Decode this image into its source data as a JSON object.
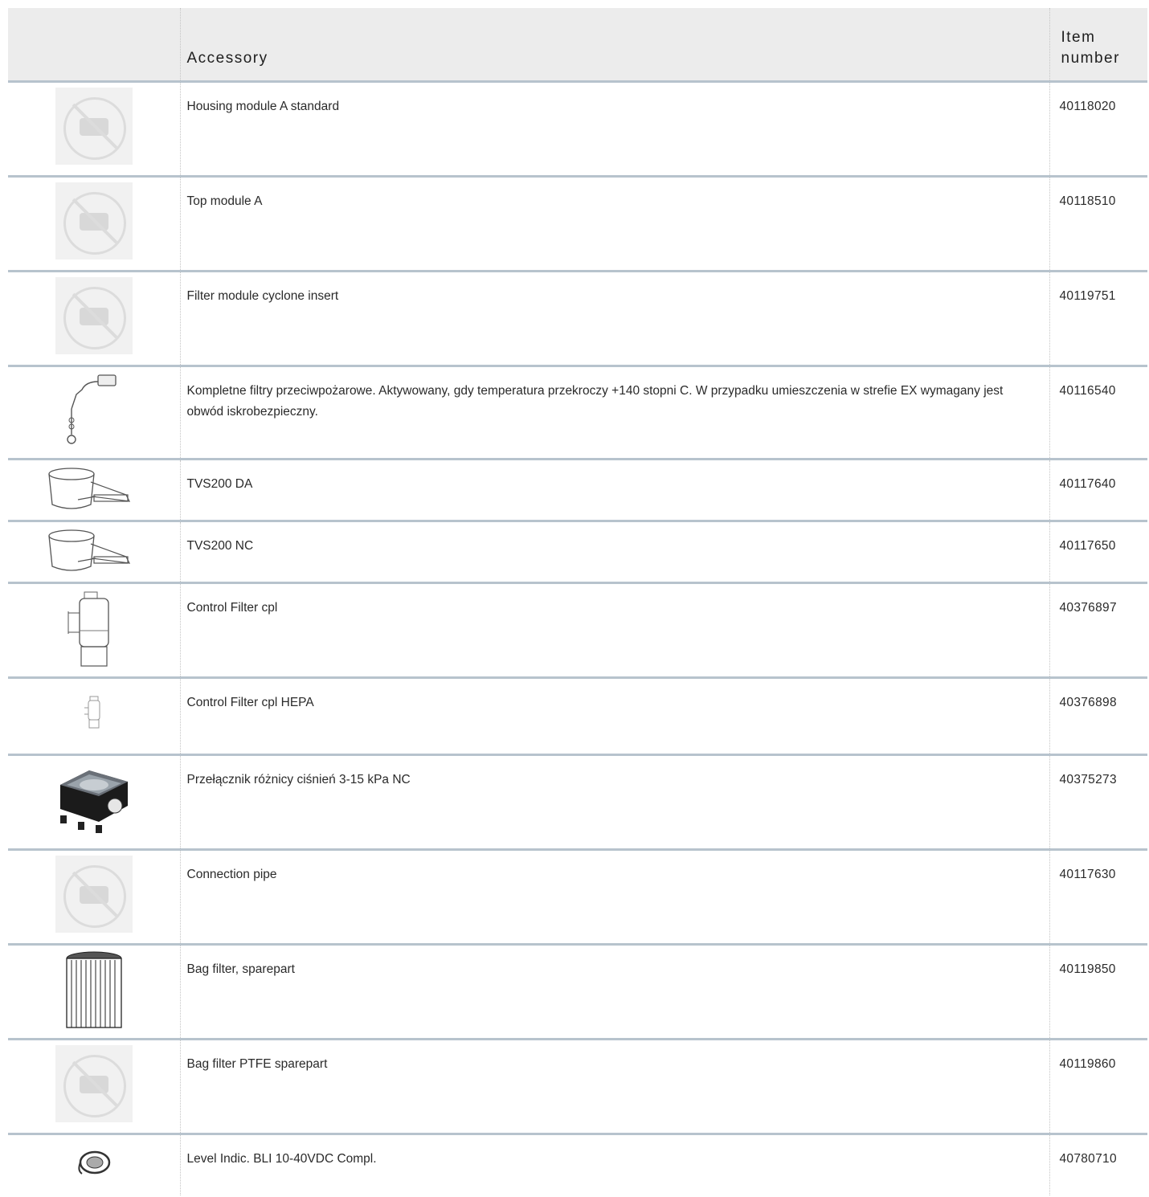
{
  "table": {
    "headers": {
      "accessory": "Accessory",
      "item_number_line1": "Item",
      "item_number_line2": "number"
    },
    "rows": [
      {
        "accessory": "Housing module A standard",
        "item_number": "40118020",
        "icon": "no-image-placeholder-icon"
      },
      {
        "accessory": "Top module A",
        "item_number": "40118510",
        "icon": "no-image-placeholder-icon"
      },
      {
        "accessory": "Filter module cyclone insert",
        "item_number": "40119751",
        "icon": "no-image-placeholder-icon"
      },
      {
        "accessory": "Kompletne filtry przeciwpożarowe. Aktywowany, gdy temperatura przekroczy +140 stopni C. W przypadku umieszczenia w strefie EX wymagany jest obwód iskrobezpieczny.",
        "item_number": "40116540",
        "icon": "fire-sensor-icon"
      },
      {
        "accessory": "TVS200 DA",
        "item_number": "40117640",
        "icon": "damper-valve-icon"
      },
      {
        "accessory": "TVS200 NC",
        "item_number": "40117650",
        "icon": "damper-valve-icon"
      },
      {
        "accessory": "Control Filter cpl",
        "item_number": "40376897",
        "icon": "control-filter-icon"
      },
      {
        "accessory": "Control Filter cpl HEPA",
        "item_number": "40376898",
        "icon": "control-filter-small-icon"
      },
      {
        "accessory": "Przełącznik różnicy ciśnień 3-15 kPa NC",
        "item_number": "40375273",
        "icon": "pressure-switch-icon"
      },
      {
        "accessory": "Connection pipe",
        "item_number": "40117630",
        "icon": "no-image-placeholder-icon"
      },
      {
        "accessory": "Bag filter, sparepart",
        "item_number": "40119850",
        "icon": "bag-filter-icon"
      },
      {
        "accessory": "Bag filter PTFE sparepart",
        "item_number": "40119860",
        "icon": "no-image-placeholder-icon"
      },
      {
        "accessory": "Level Indic. BLI 10-40VDC Compl.",
        "item_number": "40780710",
        "icon": "level-indicator-icon"
      }
    ]
  }
}
